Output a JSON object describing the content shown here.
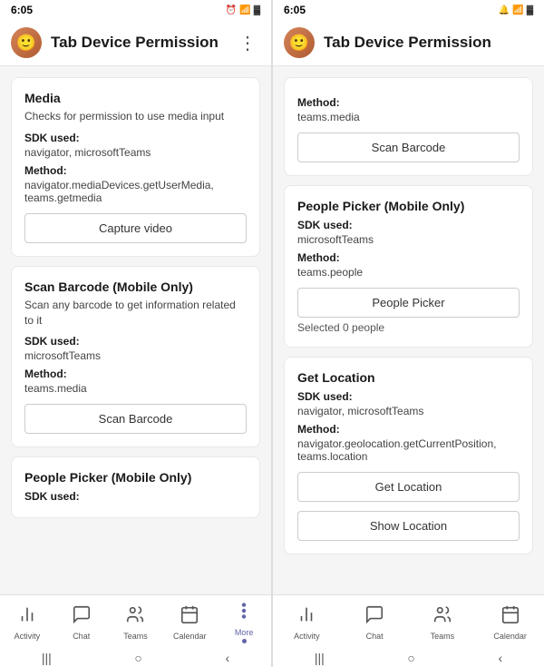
{
  "left": {
    "statusBar": {
      "time": "6:05",
      "icons": "⚙ 📶 🔋"
    },
    "header": {
      "title": "Tab Device Permission",
      "avatarText": "👤",
      "moreIcon": "⋮"
    },
    "cards": [
      {
        "id": "media",
        "title": "Media",
        "desc": "Checks for permission to use media input",
        "sdkLabel": "SDK used:",
        "sdkValue": "navigator, microsoftTeams",
        "methodLabel": "Method:",
        "methodValue": "navigator.mediaDevices.getUserMedia, teams.getmedia",
        "buttonLabel": "Capture video",
        "hasButton": true
      },
      {
        "id": "scan-barcode",
        "title": "Scan Barcode (Mobile Only)",
        "desc": "Scan any barcode to get information related to it",
        "sdkLabel": "SDK used:",
        "sdkValue": "microsoftTeams",
        "methodLabel": "Method:",
        "methodValue": "teams.media",
        "buttonLabel": "Scan Barcode",
        "hasButton": true
      },
      {
        "id": "people-picker",
        "title": "People Picker (Mobile Only)",
        "desc": "",
        "sdkLabel": "SDK used:",
        "sdkValue": "",
        "methodLabel": "",
        "methodValue": "",
        "buttonLabel": "",
        "hasButton": false,
        "partial": true
      }
    ],
    "nav": [
      {
        "icon": "☰",
        "label": "Activity",
        "active": false
      },
      {
        "icon": "💬",
        "label": "Chat",
        "active": false
      },
      {
        "icon": "👥",
        "label": "Teams",
        "active": false
      },
      {
        "icon": "📅",
        "label": "Calendar",
        "active": false
      },
      {
        "icon": "•••",
        "label": "More",
        "active": true
      }
    ]
  },
  "right": {
    "statusBar": {
      "time": "6:05",
      "icons": "⚙ 📶 🔋"
    },
    "header": {
      "title": "Tab Device Permission",
      "avatarText": "👤",
      "bellIcon": "🔔"
    },
    "sections": [
      {
        "id": "scan-barcode-right",
        "hasTitle": false,
        "methodLabel": "Method:",
        "methodValue": "teams.media",
        "buttonLabel": "Scan Barcode",
        "hasButton": true,
        "extraContent": []
      },
      {
        "id": "people-picker-right",
        "title": "People Picker (Mobile Only)",
        "sdkLabel": "SDK used:",
        "sdkValue": "microsoftTeams",
        "methodLabel": "Method:",
        "methodValue": "teams.people",
        "buttonLabel": "People Picker",
        "hasButton": true,
        "selectedText": "Selected 0 people"
      },
      {
        "id": "get-location-right",
        "title": "Get Location",
        "sdkLabel": "SDK used:",
        "sdkValue": "navigator, microsoftTeams",
        "methodLabel": "Method:",
        "methodValue": "navigator.geolocation.getCurrentPosition, teams.location",
        "button1Label": "Get Location",
        "button2Label": "Show Location",
        "hasTwoButtons": true
      }
    ],
    "nav": [
      {
        "icon": "☰",
        "label": "Activity",
        "active": false
      },
      {
        "icon": "💬",
        "label": "Chat",
        "active": false
      },
      {
        "icon": "👥",
        "label": "Teams",
        "active": false
      },
      {
        "icon": "📅",
        "label": "Calendar",
        "active": false
      }
    ]
  }
}
